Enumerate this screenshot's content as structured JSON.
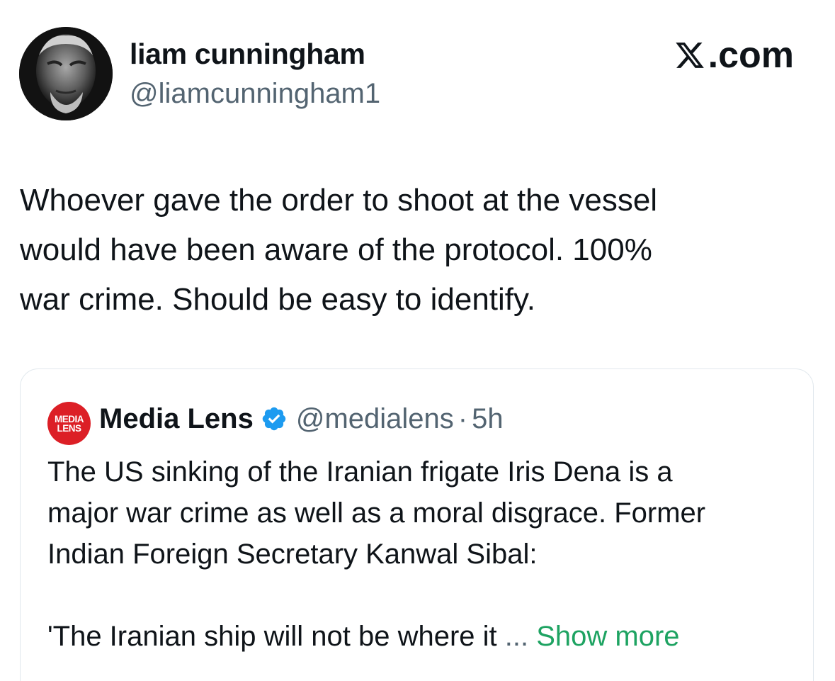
{
  "author": {
    "display_name": "liam cunningham",
    "handle": "@liamcunningham1",
    "avatar_icon": "profile-photo"
  },
  "site": {
    "label": ".com",
    "icon": "x-logo-icon"
  },
  "tweet": {
    "lines": [
      "Whoever gave the order to shoot at the vessel",
      "would have been aware of the protocol. 100%",
      "war crime. Should be easy to identify."
    ]
  },
  "quoted_tweet": {
    "logo_lines": [
      "MEDIA",
      "LENS"
    ],
    "display_name": "Media Lens",
    "verified_icon": "verified-badge-icon",
    "handle": "@medialens",
    "separator": "·",
    "time": "5h",
    "lines": [
      "The US sinking of the Iranian frigate Iris Dena is a",
      "major war crime as well as a moral disgrace. Former",
      "Indian Foreign Secretary Kanwal Sibal:",
      "'The Iranian ship will not be where it"
    ],
    "ellipsis": "...",
    "show_more_label": "Show more"
  },
  "colors": {
    "text": "#0f1419",
    "secondary": "#536471",
    "verified": "#1d9bf0",
    "show_more": "#1ea362",
    "media_lens_red": "#dc1f26",
    "border": "#e1e8ed"
  }
}
